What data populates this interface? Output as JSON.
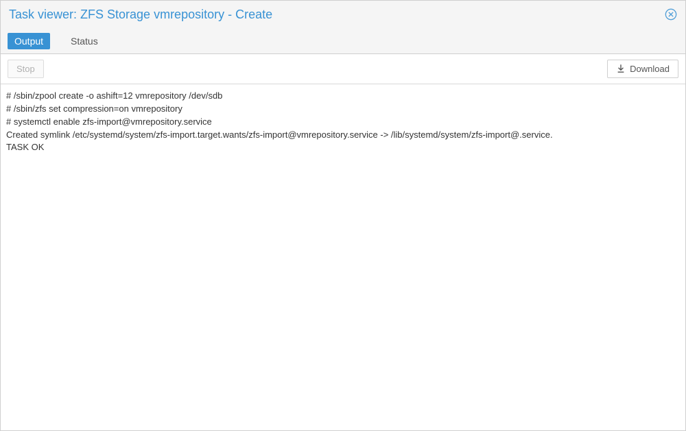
{
  "title": "Task viewer: ZFS Storage vmrepository - Create",
  "tabs": {
    "output_label": "Output",
    "status_label": "Status"
  },
  "toolbar": {
    "stop_label": "Stop",
    "download_label": "Download"
  },
  "log": "# /sbin/zpool create -o ashift=12 vmrepository /dev/sdb\n# /sbin/zfs set compression=on vmrepository\n# systemctl enable zfs-import@vmrepository.service\nCreated symlink /etc/systemd/system/zfs-import.target.wants/zfs-import@vmrepository.service -> /lib/systemd/system/zfs-import@.service.\nTASK OK"
}
